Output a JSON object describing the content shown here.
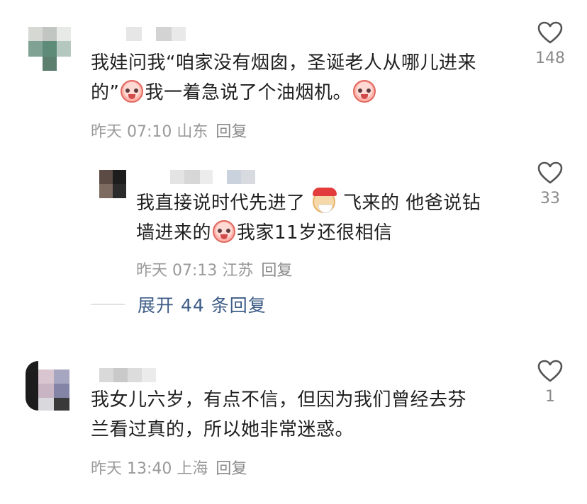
{
  "comments": [
    {
      "text_line1": "我娃问我“咱家没有烟囱，圣诞老人从哪儿进来",
      "text_line2a": "的”",
      "text_line2b": "我一着急说了个油烟机。",
      "time": "昨天 07:10",
      "location": "山东",
      "reply_label": "回复",
      "like_count": "148"
    },
    {
      "text_line1a": "我直接说时代先进了",
      "text_line1b": "飞来的 他爸说钻",
      "text_line2a": "墙进来的",
      "text_line2b": "我家11岁还很相信",
      "time": "昨天 07:13",
      "location": "江苏",
      "reply_label": "回复",
      "like_count": "33"
    },
    {
      "text_line1": "我女儿六岁，有点不信，但因为我们曾经去芬",
      "text_line2": "兰看过真的，所以她非常迷惑。",
      "time": "昨天 13:40",
      "location": "上海",
      "reply_label": "回复",
      "like_count": "1"
    }
  ],
  "expand_replies": "展开 44 条回复",
  "icons": {
    "like": "heart-outline-icon",
    "emoji_cry": "crying-face-emoji-icon",
    "emoji_santa": "santa-emoji-icon"
  },
  "colors": {
    "link": "#3d5c86",
    "meta": "#999999",
    "text": "#1f1f1f"
  }
}
